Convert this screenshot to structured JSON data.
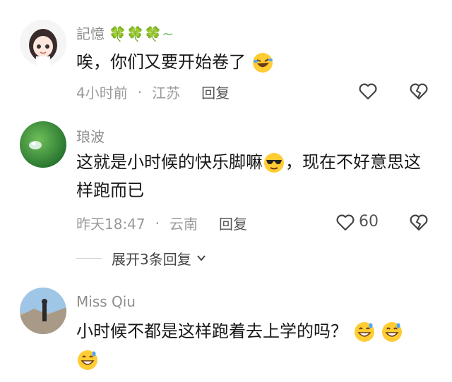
{
  "comments": [
    {
      "username": "記憶",
      "username_decoration": "🍀🍀🍀~",
      "text": "唉，你们又要开始卷了",
      "emoji": "rofl-emoji",
      "time": "4小时前",
      "location": "江苏",
      "reply_label": "回复",
      "like_count": ""
    },
    {
      "username": "琅波",
      "text_before": "这就是小时候的快乐脚嘛",
      "text_after": "，现在不好意思这样跑而已",
      "emoji": "sunglasses-emoji",
      "time": "昨天18:47",
      "location": "云南",
      "reply_label": "回复",
      "like_count": "60"
    },
    {
      "username": "Miss Qiu",
      "text": "小时候不都是这样跑着去上学的吗？",
      "emoji": "grin-sweat-emoji"
    }
  ],
  "expand_replies": {
    "label": "展开3条回复"
  }
}
